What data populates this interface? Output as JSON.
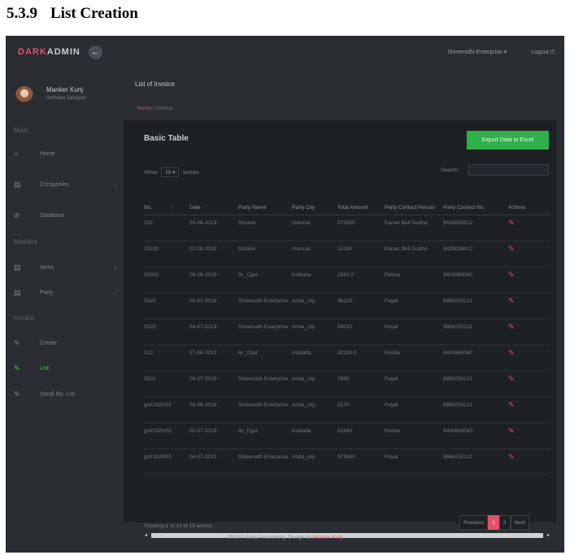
{
  "doc": {
    "number": "5.3.9",
    "title": "List Creation"
  },
  "topbar": {
    "brand_part1": "DARK",
    "brand_part2": "ADMIN",
    "back_glyph": "←",
    "company": "Shreenidhi Enterprise",
    "logout": "Logout"
  },
  "profile": {
    "name": "Manker Kunj",
    "role": "Software Designer"
  },
  "sidebar": {
    "section_main": "Main",
    "section_masters": "Masters",
    "section_invoice": "Invoice",
    "items": [
      {
        "label": "Home",
        "icon": "home-icon"
      },
      {
        "label": "Companies",
        "icon": "building-icon"
      },
      {
        "label": "Database",
        "icon": "database-icon"
      },
      {
        "label": "Items",
        "icon": "items-icon"
      },
      {
        "label": "Party",
        "icon": "party-icon"
      },
      {
        "label": "Create",
        "icon": "create-icon"
      },
      {
        "label": "List",
        "icon": "list-icon"
      },
      {
        "label": "Small No. List",
        "icon": "small-list-icon"
      }
    ]
  },
  "page": {
    "title": "List of Invoice",
    "crumb_home": "Home",
    "crumb_sep": "/",
    "crumb_current": "Invoice"
  },
  "card": {
    "title": "Basic Table",
    "export_label": "Export Data to Excel",
    "show_label": "Show",
    "show_value": "10",
    "entries_label": "entries",
    "search_label": "Search:",
    "search_value": "",
    "columns": [
      "No.",
      "Date",
      "Party Name",
      "Party City",
      "Total Amount",
      "Party Contact Person",
      "Party Contact No.",
      "Actions"
    ],
    "rows": [
      [
        "102",
        "25-06-2019",
        "Stocker",
        "chennai",
        "572560",
        "Kanan Bell Dodha",
        "9428839812"
      ],
      [
        "25100",
        "02-08-2019",
        "Stocker",
        "chennai",
        "13160",
        "Kanan Bell Dodha",
        "9428839812"
      ],
      [
        "50000",
        "08-06-2019",
        "Itc_Cgst",
        "Kolkatta",
        "2560.0",
        "Rekha",
        "9400660060"
      ],
      [
        "5025",
        "04-07-2019",
        "Shreenath Enterprise",
        "Anda_city",
        "46120",
        "Payal",
        "8866250121"
      ],
      [
        "5025",
        "04-07-2019",
        "Shreenath Enterprise",
        "Anda_city",
        "59520",
        "Payal",
        "8866250121"
      ],
      [
        "312",
        "27-06-2019",
        "Itc_Cgst",
        "Kolkatta",
        "32200.0",
        "Rekha",
        "9400660060"
      ],
      [
        "5501",
        "09-07-2019",
        "Shreenath Enterprise",
        "Anda_city",
        "7680",
        "Payal",
        "8866250121"
      ],
      [
        "gst/1920/01",
        "28-06-2019",
        "Shreenath Enterprise",
        "Anda_city",
        "5120",
        "Payal",
        "8866250121"
      ],
      [
        "gst/1920/02",
        "02-07-2019",
        "Itc_Cgst",
        "Kolkatta",
        "81840",
        "Rekha",
        "9400660060"
      ],
      [
        "gst/1920/03",
        "04-07-2019",
        "Shreenath Enterprise",
        "Anda_city",
        "573840",
        "Payal",
        "8866250121"
      ]
    ],
    "info": "Showing 1 to 10 of 15 entries",
    "pager": {
      "prev": "Previous",
      "page1": "1",
      "page2": "2",
      "next": "Next"
    }
  },
  "footer": {
    "text": "2019 © Easy Accounting. Design by",
    "author": "Manker Kunj"
  },
  "colors": {
    "accent": "#e0506a",
    "success": "#2eb04a",
    "bg": "#2a2d31",
    "card": "#1e2124"
  }
}
